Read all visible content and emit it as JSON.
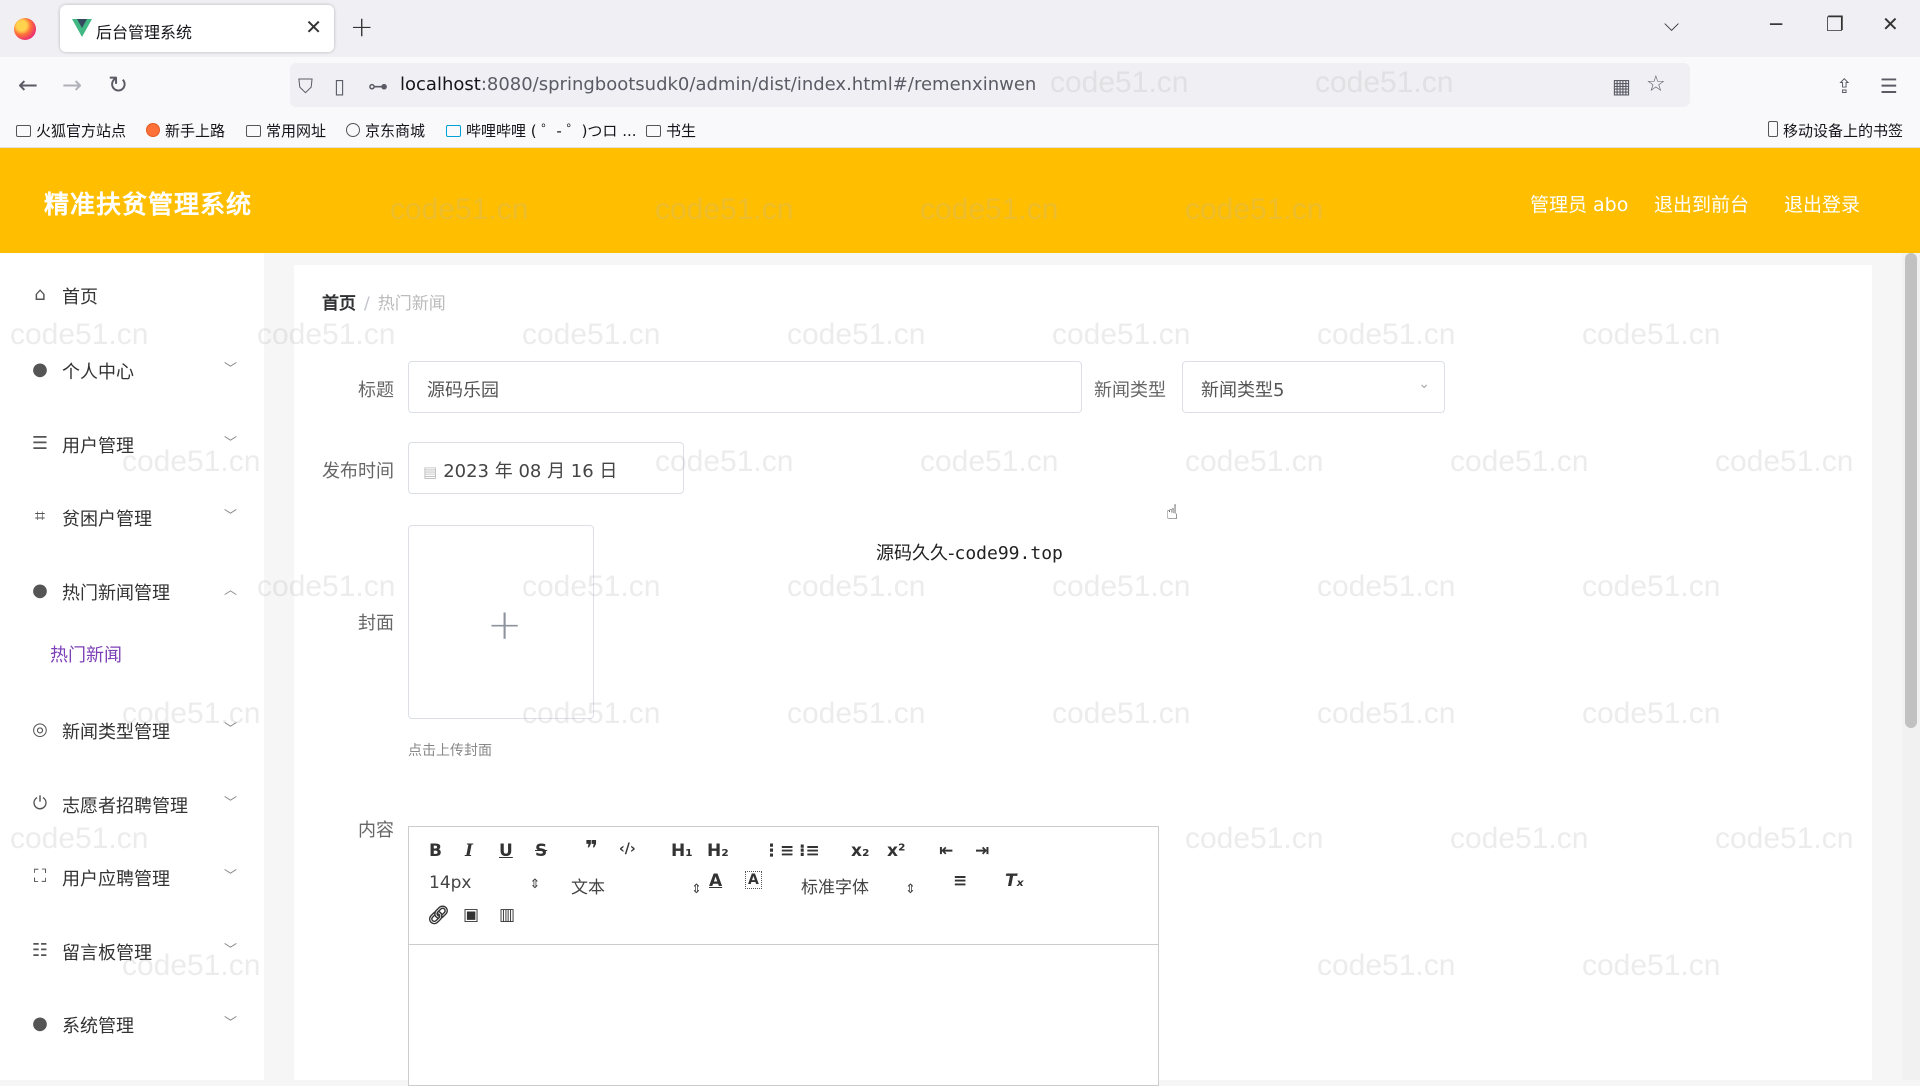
{
  "browser": {
    "tab_title": "后台管理系统",
    "url_host": "localhost",
    "url_rest": ":8080/springbootsudk0/admin/dist/index.html#/remenxinwen",
    "bookmarks": [
      "火狐官方站点",
      "新手上路",
      "常用网址",
      "京东商城",
      "哔哩哔哩 ( ゜- ゜)つロ ...",
      "书生"
    ],
    "mobile_bookmarks": "移动设备上的书签"
  },
  "header": {
    "title": "精准扶贫管理系统",
    "admin": "管理员 abo",
    "to_front": "退出到前台",
    "logout": "退出登录"
  },
  "sidebar": {
    "items": [
      {
        "label": "首页"
      },
      {
        "label": "个人中心"
      },
      {
        "label": "用户管理"
      },
      {
        "label": "贫困户管理"
      },
      {
        "label": "热门新闻管理"
      },
      {
        "label": "新闻类型管理"
      },
      {
        "label": "志愿者招聘管理"
      },
      {
        "label": "用户应聘管理"
      },
      {
        "label": "留言板管理"
      },
      {
        "label": "系统管理"
      }
    ],
    "sub_active": "热门新闻"
  },
  "breadcrumb": {
    "home": "首页",
    "current": "热门新闻"
  },
  "form": {
    "title_label": "标题",
    "title_value": "源码乐园",
    "type_label": "新闻类型",
    "type_value": "新闻类型5",
    "date_label": "发布时间",
    "date_value": "2023 年 08 月 16 日",
    "cover_label": "封面",
    "cover_tip": "点击上传封面",
    "content_label": "内容"
  },
  "overlay_text": {
    "prefix": "源码久久-",
    "site": "code99.top"
  },
  "editor": {
    "font_size": "14px",
    "header_select": "文本",
    "font_family": "标准字体"
  },
  "watermark": "code51.cn"
}
